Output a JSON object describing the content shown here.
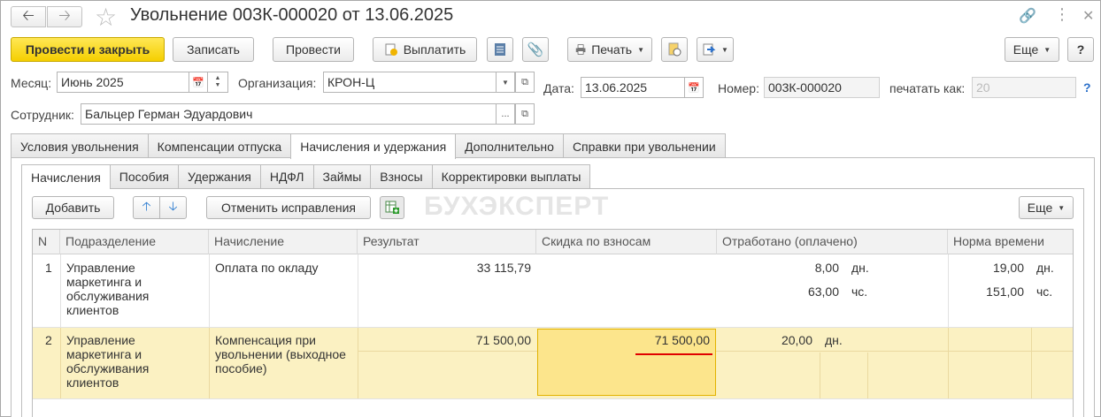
{
  "title": "Увольнение 003К-000020 от 13.06.2025",
  "toolbar": {
    "post_close": "Провести и закрыть",
    "save": "Записать",
    "post": "Провести",
    "pay": "Выплатить",
    "print": "Печать",
    "more": "Еще",
    "help": "?"
  },
  "fields": {
    "month_label": "Месяц:",
    "month_value": "Июнь 2025",
    "org_label": "Организация:",
    "org_value": "КРОН-Ц",
    "date_label": "Дата:",
    "date_value": "13.06.2025",
    "number_label": "Номер:",
    "number_value": "003К-000020",
    "print_as_label": "печатать как:",
    "print_as_value": "20",
    "employee_label": "Сотрудник:",
    "employee_value": "Бальцер Герман Эдуардович"
  },
  "tabs": [
    "Условия увольнения",
    "Компенсации отпуска",
    "Начисления и удержания",
    "Дополнительно",
    "Справки при увольнении"
  ],
  "subtabs": [
    "Начисления",
    "Пособия",
    "Удержания",
    "НДФЛ",
    "Займы",
    "Взносы",
    "Корректировки выплаты"
  ],
  "subtoolbar": {
    "add": "Добавить",
    "cancel_corrections": "Отменить исправления",
    "more": "Еще"
  },
  "watermark": "БУХЭКСПЕРТ",
  "table": {
    "headers": [
      "N",
      "Подразделение",
      "Начисление",
      "Результат",
      "Скидка по взносам",
      "Отработано (оплачено)",
      "Норма времени"
    ],
    "rows": [
      {
        "n": "1",
        "dept": "Управление маркетинга и обслуживания клиентов",
        "accrual": "Оплата по окладу",
        "result": "33 115,79",
        "discount": "",
        "worked_days": "8,00",
        "worked_days_unit": "дн.",
        "worked_hours": "63,00",
        "worked_hours_unit": "чс.",
        "norm_days": "19,00",
        "norm_days_unit": "дн.",
        "norm_hours": "151,00",
        "norm_hours_unit": "чс."
      },
      {
        "n": "2",
        "dept": "Управление маркетинга и обслуживания клиентов",
        "accrual": "Компенсация при увольнении (выходное пособие)",
        "result": "71 500,00",
        "discount": "71 500,00",
        "worked_days": "20,00",
        "worked_days_unit": "дн."
      }
    ]
  }
}
